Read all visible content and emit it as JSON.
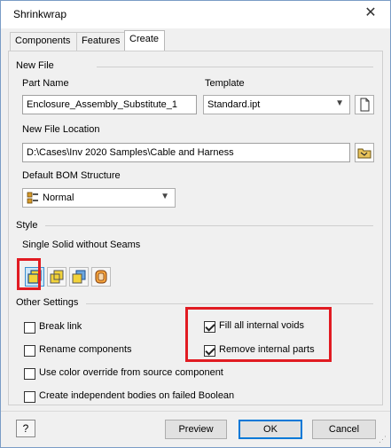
{
  "window": {
    "title": "Shrinkwrap",
    "close_symbol": "✕"
  },
  "tabs": [
    {
      "label": "Components"
    },
    {
      "label": "Features"
    },
    {
      "label": "Create",
      "active": true
    }
  ],
  "new_file": {
    "group_label": "New File",
    "part_name_label": "Part Name",
    "part_name_value": "Enclosure_Assembly_Substitute_1",
    "template_label": "Template",
    "template_value": "Standard.ipt",
    "location_label": "New File Location",
    "location_value": "D:\\Cases\\Inv 2020 Samples\\Cable and Harness",
    "bom_label": "Default BOM Structure",
    "bom_value": "Normal"
  },
  "style": {
    "group_label": "Style",
    "current_style": "Single Solid without Seams",
    "buttons": [
      {
        "name": "single-solid-no-seams-icon",
        "selected": true
      },
      {
        "name": "single-solid-seams-icon"
      },
      {
        "name": "maintain-each-solid-icon"
      },
      {
        "name": "surface-only-icon"
      }
    ]
  },
  "other_settings": {
    "group_label": "Other Settings",
    "break_link": {
      "label": "Break link",
      "checked": false
    },
    "rename_components": {
      "label": "Rename components",
      "checked": false
    },
    "color_override": {
      "label": "Use color override from source component",
      "checked": false
    },
    "independent_bodies": {
      "label": "Create independent bodies on failed Boolean",
      "checked": false
    },
    "fill_voids": {
      "label": "Fill all internal voids",
      "checked": true
    },
    "remove_internal": {
      "label": "Remove internal parts",
      "checked": true
    }
  },
  "footer": {
    "help_label": "?",
    "preview_label": "Preview",
    "ok_label": "OK",
    "cancel_label": "Cancel"
  },
  "colors": {
    "highlight_red": "#e11b22",
    "accent_blue": "#0078d7"
  }
}
